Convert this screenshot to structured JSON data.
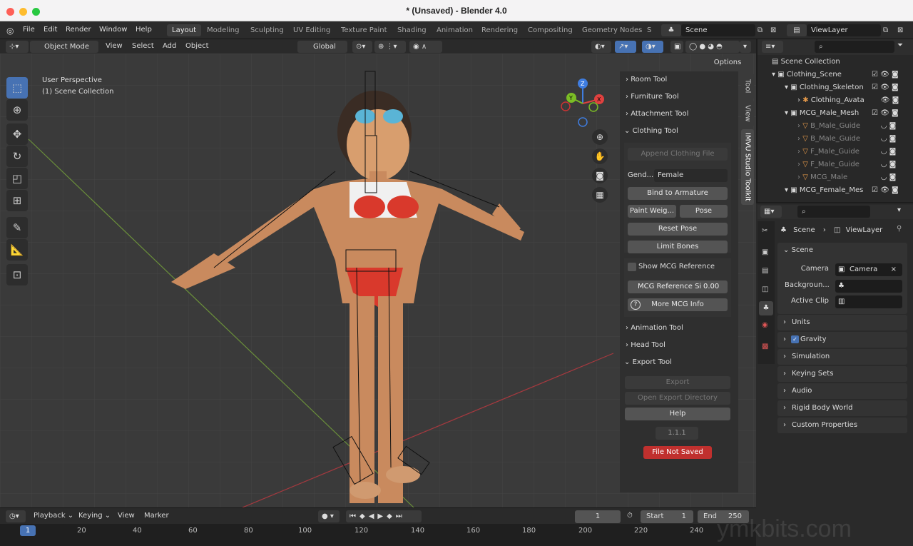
{
  "window": {
    "title": "* (Unsaved) - Blender 4.0"
  },
  "menu": [
    "File",
    "Edit",
    "Render",
    "Window",
    "Help"
  ],
  "workspaces": [
    "Layout",
    "Modeling",
    "Sculpting",
    "UV Editing",
    "Texture Paint",
    "Shading",
    "Animation",
    "Rendering",
    "Compositing",
    "Geometry Nodes",
    "S"
  ],
  "scene_field": "Scene",
  "viewlayer_field": "ViewLayer",
  "viewport_header": {
    "mode": "Object Mode",
    "view": "View",
    "select": "Select",
    "add": "Add",
    "object": "Object",
    "orientation": "Global",
    "options": "Options"
  },
  "overlay_text": {
    "line1": "User Perspective",
    "line2": "(1) Scene Collection"
  },
  "gizmo": {
    "z": "Z",
    "y": "Y",
    "x": "X"
  },
  "side_tabs": [
    "Tool",
    "View",
    "IMVU Studio Toolkit"
  ],
  "npanel": {
    "room_tool": "Room Tool",
    "furniture_tool": "Furniture Tool",
    "attachment_tool": "Attachment Tool",
    "clothing_tool": "Clothing Tool",
    "append_clothing": "Append Clothing File",
    "gender_label": "Gend...",
    "gender_value": "Female",
    "bind_armature": "Bind to Armature",
    "paint_weights": "Paint Weig...",
    "pose": "Pose",
    "reset_pose": "Reset Pose",
    "limit_bones": "Limit Bones",
    "show_mcg": "Show MCG Reference",
    "mcg_ref_label": "MCG Reference Si",
    "mcg_ref_value": "0.00",
    "more_mcg": "More MCG Info",
    "animation_tool": "Animation Tool",
    "head_tool": "Head Tool",
    "export_tool": "Export Tool",
    "export": "Export",
    "open_export_dir": "Open Export Directory",
    "help": "Help",
    "version": "1.1.1",
    "file_not_saved": "File Not Saved"
  },
  "outliner": {
    "root": "Scene Collection",
    "rows": [
      {
        "label": "Clothing_Scene",
        "indent": 1
      },
      {
        "label": "Clothing_Skeleton",
        "indent": 2
      },
      {
        "label": "Clothing_Avata",
        "indent": 3
      },
      {
        "label": "MCG_Male_Mesh",
        "indent": 2
      },
      {
        "label": "B_Male_Guide",
        "indent": 3
      },
      {
        "label": "B_Male_Guide",
        "indent": 3
      },
      {
        "label": "F_Male_Guide",
        "indent": 3
      },
      {
        "label": "F_Male_Guide",
        "indent": 3
      },
      {
        "label": "MCG_Male",
        "indent": 3
      },
      {
        "label": "MCG_Female_Mes",
        "indent": 2
      }
    ]
  },
  "properties": {
    "breadcrumb_scene": "Scene",
    "breadcrumb_layer": "ViewLayer",
    "section_scene": "Scene",
    "camera_label": "Camera",
    "camera_value": "Camera",
    "background_label": "Backgroun...",
    "active_clip_label": "Active Clip",
    "sections": [
      "Units",
      "Gravity",
      "Simulation",
      "Keying Sets",
      "Audio",
      "Rigid Body World",
      "Custom Properties"
    ]
  },
  "timeline": {
    "playback": "Playback",
    "keying": "Keying",
    "view": "View",
    "marker": "Marker",
    "current_frame": "1",
    "start_label": "Start",
    "start_value": "1",
    "end_label": "End",
    "end_value": "250",
    "ruler": [
      "1",
      "20",
      "40",
      "60",
      "80",
      "100",
      "120",
      "140",
      "160",
      "180",
      "200",
      "220",
      "240"
    ],
    "watermark": "ymkbits.com"
  }
}
